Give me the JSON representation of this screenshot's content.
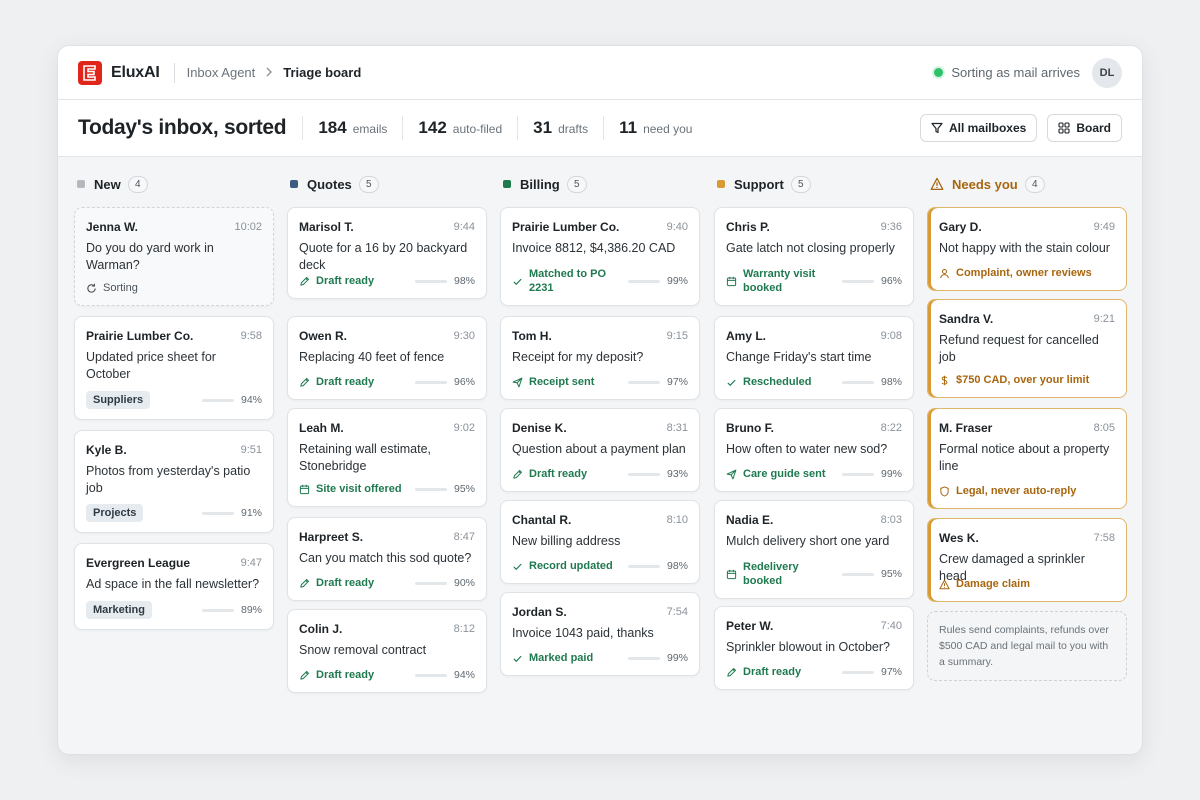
{
  "app": {
    "brand": "EluxAI",
    "breadcrumb": [
      "Inbox Agent",
      "Triage board"
    ],
    "status": "Sorting as mail arrives",
    "user_initials": "DL",
    "status_color": "#2ec26a",
    "brand_color": "#e0251b"
  },
  "summary": {
    "title": "Today's inbox, sorted",
    "stats": [
      {
        "value": "184",
        "label": "emails"
      },
      {
        "value": "142",
        "label": "auto-filed"
      },
      {
        "value": "31",
        "label": "drafts"
      },
      {
        "value": "11",
        "label": "need you"
      }
    ],
    "buttons": [
      {
        "label": "All mailboxes",
        "icon": "filter-icon"
      },
      {
        "label": "Board",
        "icon": "board-grid-icon"
      }
    ]
  },
  "columns": [
    {
      "title": "New",
      "count": "4",
      "color": "#b3b9be",
      "icon": "square",
      "cards": [
        {
          "sender": "Jenna W.",
          "time": "10:02",
          "subject": "Do you do yard work in Warman?",
          "style": "dashed",
          "action": {
            "icon": "refresh-icon",
            "text": "Sorting",
            "tone": "gray"
          }
        },
        {
          "sender": "Prairie Lumber Co.",
          "time": "9:58",
          "subject": "Updated price sheet for October",
          "tag": "Suppliers",
          "confidence": 94
        },
        {
          "sender": "Kyle B.",
          "time": "9:51",
          "subject": "Photos from yesterday's patio job",
          "tag": "Projects",
          "confidence": 91
        },
        {
          "sender": "Evergreen League",
          "time": "9:47",
          "subject": "Ad space in the fall newsletter?",
          "tag": "Marketing",
          "confidence": 89
        }
      ]
    },
    {
      "title": "Quotes",
      "count": "5",
      "color": "#3d5a80",
      "icon": "square",
      "cards": [
        {
          "sender": "Marisol T.",
          "time": "9:44",
          "subject": "Quote for a 16 by 20 backyard deck",
          "action": {
            "icon": "pencil-icon",
            "text": "Draft ready"
          },
          "confidence": 98
        },
        {
          "sender": "Owen R.",
          "time": "9:30",
          "subject": "Replacing 40 feet of fence",
          "action": {
            "icon": "pencil-icon",
            "text": "Draft ready"
          },
          "confidence": 96
        },
        {
          "sender": "Leah M.",
          "time": "9:02",
          "subject": "Retaining wall estimate, Stonebridge",
          "action": {
            "icon": "calendar-icon",
            "text": "Site visit offered"
          },
          "confidence": 95
        },
        {
          "sender": "Harpreet S.",
          "time": "8:47",
          "subject": "Can you match this sod quote?",
          "action": {
            "icon": "pencil-icon",
            "text": "Draft ready"
          },
          "confidence": 90
        },
        {
          "sender": "Colin J.",
          "time": "8:12",
          "subject": "Snow removal contract",
          "action": {
            "icon": "pencil-icon",
            "text": "Draft ready"
          },
          "confidence": 94
        }
      ]
    },
    {
      "title": "Billing",
      "count": "5",
      "color": "#1f7a4f",
      "icon": "square",
      "cards": [
        {
          "sender": "Prairie Lumber Co.",
          "time": "9:40",
          "subject": "Invoice 8812, $4,386.20 CAD",
          "action": {
            "icon": "check-icon",
            "text": "Matched to PO 2231"
          },
          "confidence": 99
        },
        {
          "sender": "Tom H.",
          "time": "9:15",
          "subject": "Receipt for my deposit?",
          "action": {
            "icon": "send-icon",
            "text": "Receipt sent"
          },
          "confidence": 97
        },
        {
          "sender": "Denise K.",
          "time": "8:31",
          "subject": "Question about a payment plan",
          "action": {
            "icon": "pencil-icon",
            "text": "Draft ready"
          },
          "confidence": 93
        },
        {
          "sender": "Chantal R.",
          "time": "8:10",
          "subject": "New billing address",
          "action": {
            "icon": "check-icon",
            "text": "Record updated"
          },
          "confidence": 98
        },
        {
          "sender": "Jordan S.",
          "time": "7:54",
          "subject": "Invoice 1043 paid, thanks",
          "action": {
            "icon": "check-icon",
            "text": "Marked paid"
          },
          "confidence": 99
        }
      ]
    },
    {
      "title": "Support",
      "count": "5",
      "color": "#d99a33",
      "icon": "square",
      "cards": [
        {
          "sender": "Chris P.",
          "time": "9:36",
          "subject": "Gate latch not closing properly",
          "action": {
            "icon": "calendar-icon",
            "text": "Warranty visit booked"
          },
          "confidence": 96
        },
        {
          "sender": "Amy L.",
          "time": "9:08",
          "subject": "Change Friday's start time",
          "action": {
            "icon": "check-icon",
            "text": "Rescheduled"
          },
          "confidence": 98
        },
        {
          "sender": "Bruno F.",
          "time": "8:22",
          "subject": "How often to water new sod?",
          "action": {
            "icon": "send-icon",
            "text": "Care guide sent"
          },
          "confidence": 99
        },
        {
          "sender": "Nadia E.",
          "time": "8:03",
          "subject": "Mulch delivery short one yard",
          "action": {
            "icon": "calendar-icon",
            "text": "Redelivery booked"
          },
          "confidence": 95
        },
        {
          "sender": "Peter W.",
          "time": "7:40",
          "subject": "Sprinkler blowout in October?",
          "action": {
            "icon": "pencil-icon",
            "text": "Draft ready"
          },
          "confidence": 97
        }
      ]
    },
    {
      "title": "Needs you",
      "count": "4",
      "color": "#a8660f",
      "icon": "warning-icon",
      "cards": [
        {
          "sender": "Gary D.",
          "time": "9:49",
          "subject": "Not happy with the stain colour",
          "style": "warn",
          "action": {
            "icon": "person-icon",
            "text": "Complaint, owner reviews",
            "tone": "warn"
          }
        },
        {
          "sender": "Sandra V.",
          "time": "9:21",
          "subject": "Refund request for cancelled job",
          "style": "warn",
          "action": {
            "icon": "dollar-icon",
            "text": "$750 CAD, over your limit",
            "tone": "warn"
          }
        },
        {
          "sender": "M. Fraser",
          "time": "8:05",
          "subject": "Formal notice about a property line",
          "style": "warn",
          "action": {
            "icon": "shield-icon",
            "text": "Legal, never auto-reply",
            "tone": "warn"
          }
        },
        {
          "sender": "Wes K.",
          "time": "7:58",
          "subject": "Crew damaged a sprinkler head",
          "style": "warn",
          "action": {
            "icon": "warning-icon",
            "text": "Damage claim",
            "tone": "warn"
          }
        }
      ],
      "note": "Rules send complaints, refunds over $500 CAD and legal mail to you with a summary."
    }
  ]
}
